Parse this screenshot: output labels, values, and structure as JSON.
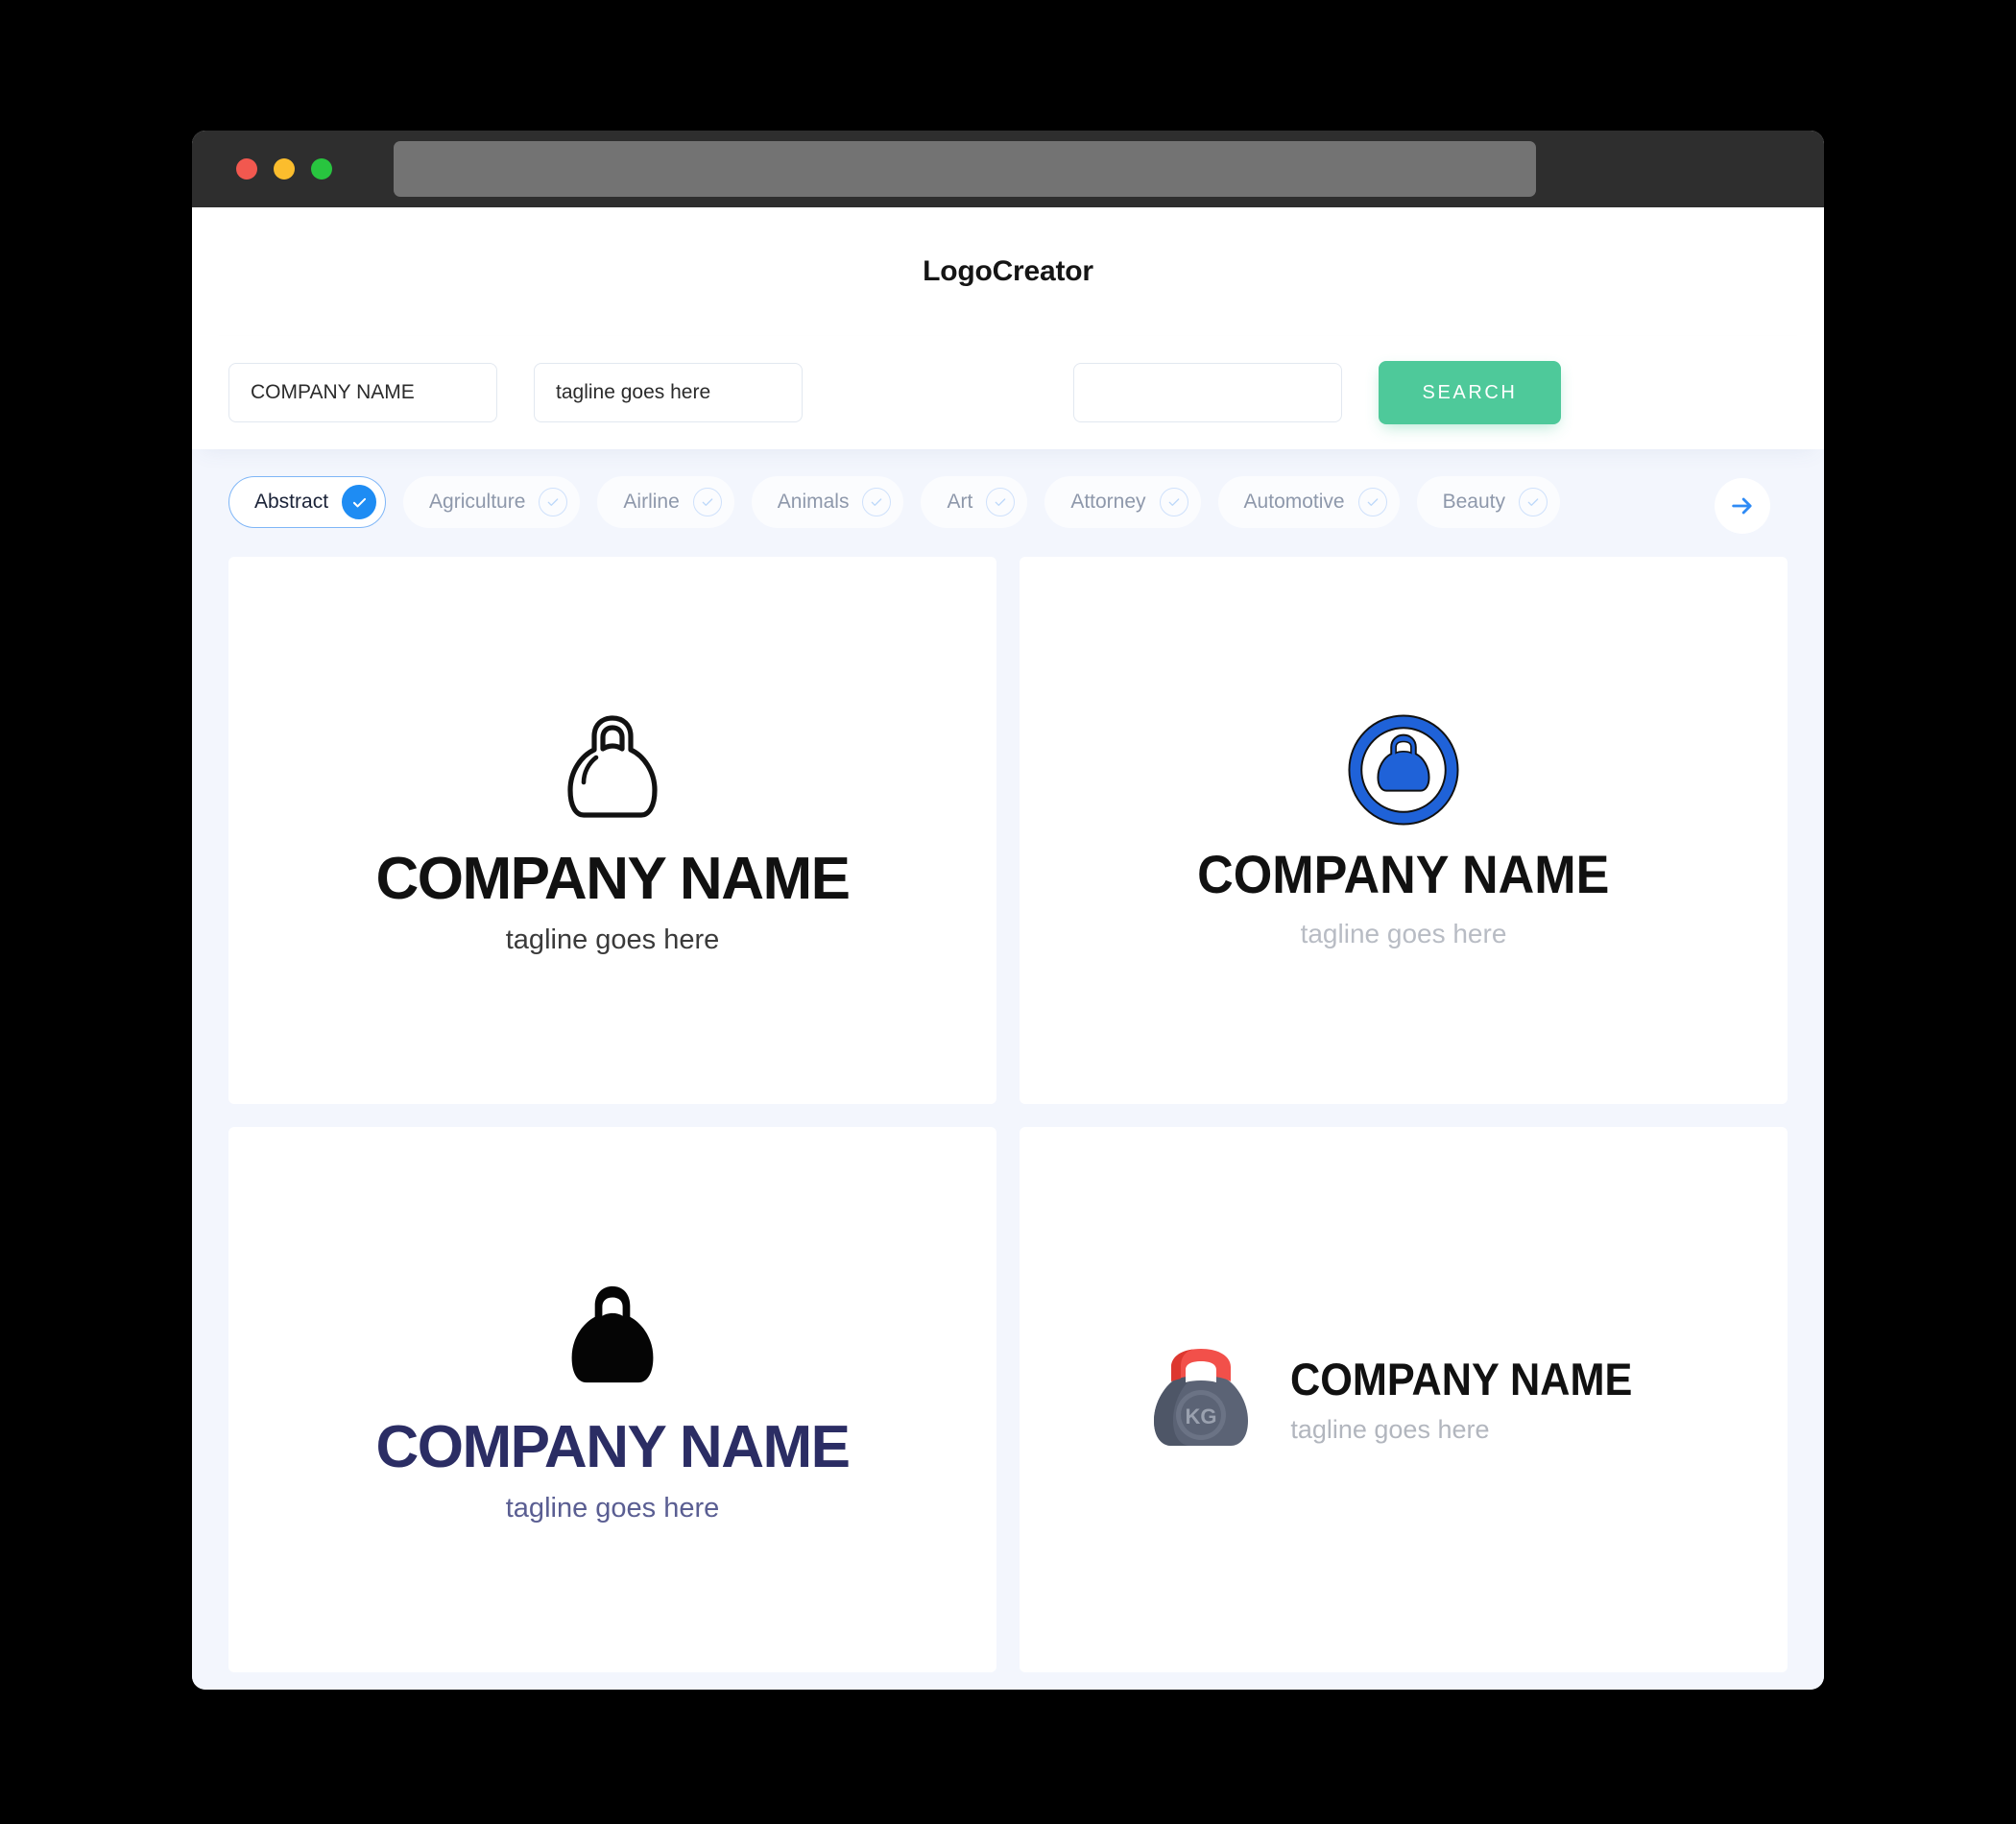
{
  "window": {
    "traffic_lights": [
      {
        "name": "close-button",
        "color": "#f2584f"
      },
      {
        "name": "minimize-button",
        "color": "#fbbd2d"
      },
      {
        "name": "maximize-button",
        "color": "#28c53f"
      }
    ],
    "url_bar_value": ""
  },
  "header": {
    "title": "LogoCreator"
  },
  "search": {
    "company_name_value": "COMPANY NAME",
    "company_name_placeholder": "COMPANY NAME",
    "tagline_value": "tagline goes here",
    "tagline_placeholder": "tagline goes here",
    "extra_value": "",
    "extra_placeholder": "",
    "button_label": "SEARCH",
    "button_color": "#4ec99a"
  },
  "categories": {
    "next_icon": "arrow-right-icon",
    "items": [
      {
        "label": "Abstract",
        "selected": true
      },
      {
        "label": "Agriculture",
        "selected": false
      },
      {
        "label": "Airline",
        "selected": false
      },
      {
        "label": "Animals",
        "selected": false
      },
      {
        "label": "Art",
        "selected": false
      },
      {
        "label": "Attorney",
        "selected": false
      },
      {
        "label": "Automotive",
        "selected": false
      },
      {
        "label": "Beauty",
        "selected": false
      }
    ],
    "selected_accent": "#1e8cf3"
  },
  "logos": [
    {
      "id": "logo-card-1",
      "icon": "kettlebell-outline-icon",
      "layout": "stacked",
      "name": "COMPANY NAME",
      "tagline": "tagline goes here",
      "name_color": "#111111",
      "tagline_color": "#3a3a3a",
      "icon_color": "#111111"
    },
    {
      "id": "logo-card-2",
      "icon": "kettlebell-circle-blue-icon",
      "layout": "stacked",
      "name": "COMPANY NAME",
      "tagline": "tagline goes here",
      "name_color": "#111111",
      "tagline_color": "#b8bcc4",
      "icon_color": "#1f62d8"
    },
    {
      "id": "logo-card-3",
      "icon": "kettlebell-solid-icon",
      "layout": "stacked",
      "name": "COMPANY NAME",
      "tagline": "tagline goes here",
      "name_color": "#2b2d64",
      "tagline_color": "#5a5e92",
      "icon_color": "#050505"
    },
    {
      "id": "logo-card-4",
      "icon": "kettlebell-kg-icon",
      "layout": "horizontal",
      "name": "COMPANY NAME",
      "tagline": "tagline goes here",
      "name_color": "#111111",
      "tagline_color": "#b2b6be",
      "icon_badge_text": "KG",
      "icon_handle_color": "#e8453c",
      "icon_body_color": "#5b6375"
    }
  ]
}
